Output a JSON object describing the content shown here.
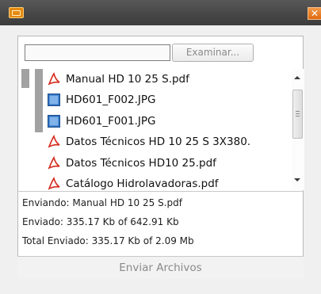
{
  "window": {
    "close_glyph": "✕",
    "app_icon": "upload-app-icon"
  },
  "selector": {
    "path_value": "",
    "browse_label": "Examinar..."
  },
  "files": [
    {
      "name": "Manual HD 10 25 S.pdf",
      "icon": "pdf-icon"
    },
    {
      "name": "HD601_F002.JPG",
      "icon": "image-icon"
    },
    {
      "name": "HD601_F001.JPG",
      "icon": "image-icon"
    },
    {
      "name": "Datos Técnicos HD 10 25 S 3X380.",
      "icon": "pdf-icon"
    },
    {
      "name": "Datos Técnicos HD10 25.pdf",
      "icon": "pdf-icon"
    },
    {
      "name": "Catálogo Hidrolavadoras.pdf",
      "icon": "pdf-icon"
    }
  ],
  "status": {
    "sending": "Enviando: Manual HD 10 25 S.pdf",
    "sent": "Enviado: 335.17 Kb of 642.91 Kb",
    "total": "Total Enviado: 335.17 Kb of 2.09 Mb"
  },
  "actions": {
    "send_label": "Enviar Archivos"
  },
  "colors": {
    "titlebar": "#474747",
    "accent": "#e38a12",
    "pdf_red": "#d52b1e",
    "image_blue": "#2e6fc0"
  }
}
